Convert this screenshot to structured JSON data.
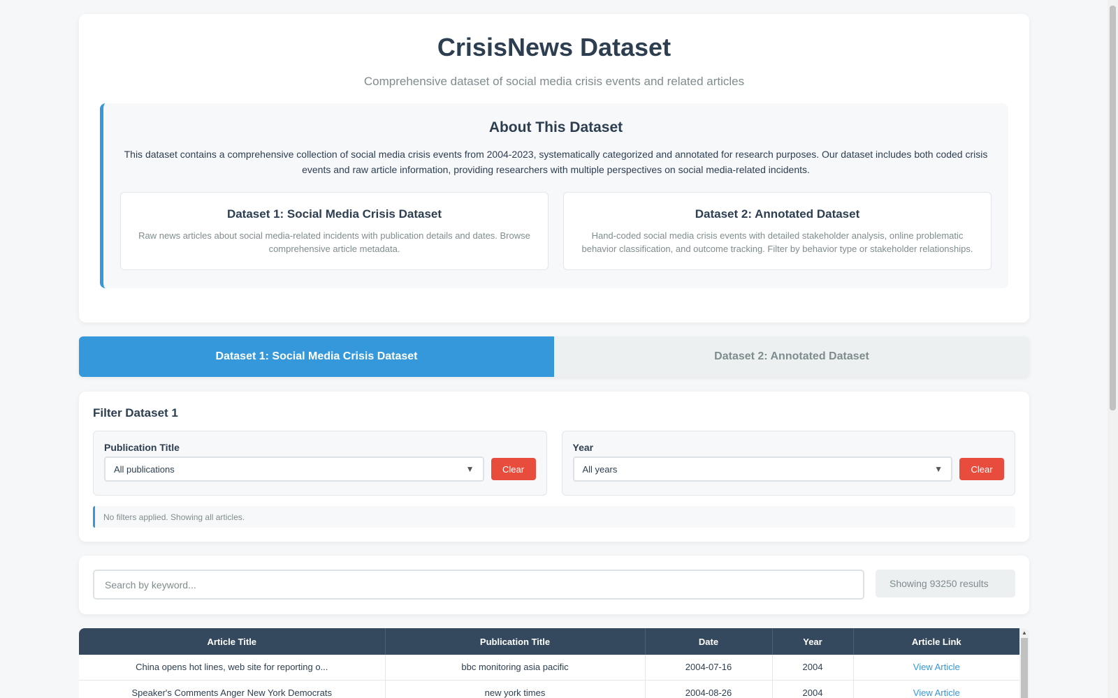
{
  "header": {
    "title": "CrisisNews Dataset",
    "subtitle": "Comprehensive dataset of social media crisis events and related articles"
  },
  "about": {
    "title": "About This Dataset",
    "description": "This dataset contains a comprehensive collection of social media crisis events from 2004-2023, systematically categorized and annotated for research purposes. Our dataset includes both coded crisis events and raw article information, providing researchers with multiple perspectives on social media-related incidents.",
    "datasets": [
      {
        "title": "Dataset 1: Social Media Crisis Dataset",
        "description": "Raw news articles about social media-related incidents with publication details and dates. Browse comprehensive article metadata."
      },
      {
        "title": "Dataset 2: Annotated Dataset",
        "description": "Hand-coded social media crisis events with detailed stakeholder analysis, online problematic behavior classification, and outcome tracking. Filter by behavior type or stakeholder relationships."
      }
    ]
  },
  "tabs": [
    {
      "label": "Dataset 1: Social Media Crisis Dataset",
      "active": true
    },
    {
      "label": "Dataset 2: Annotated Dataset",
      "active": false
    }
  ],
  "filters": {
    "heading": "Filter Dataset 1",
    "publication": {
      "label": "Publication Title",
      "value": "All publications",
      "clear": "Clear"
    },
    "year": {
      "label": "Year",
      "value": "All years",
      "clear": "Clear"
    },
    "status": "No filters applied. Showing all articles."
  },
  "search": {
    "placeholder": "Search by keyword...",
    "result_count": "Showing 93250 results"
  },
  "table": {
    "columns": [
      "Article Title",
      "Publication Title",
      "Date",
      "Year",
      "Article Link"
    ],
    "rows": [
      [
        "China opens hot lines, web site for reporting o...",
        "bbc monitoring asia pacific",
        "2004-07-16",
        "2004",
        "View Article"
      ],
      [
        "Speaker's Comments Anger New York Democrats",
        "new york times",
        "2004-08-26",
        "2004",
        "View Article"
      ]
    ]
  },
  "colors": {
    "accent": "#3498db",
    "danger": "#e74c3c",
    "header_dark": "#34495e"
  },
  "icons": {
    "select_arrow": "chevron-down-icon"
  }
}
